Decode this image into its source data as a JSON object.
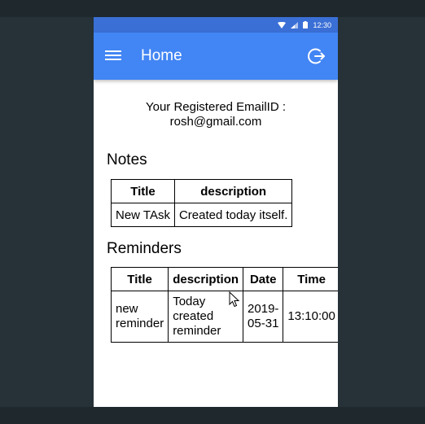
{
  "statusbar": {
    "time": "12:30"
  },
  "appbar": {
    "title": "Home"
  },
  "email": {
    "label": "Your Registered EmailID :",
    "value": "rosh@gmail.com"
  },
  "notes": {
    "title": "Notes",
    "headers": [
      "Title",
      "description"
    ],
    "rows": [
      [
        "New TAsk",
        "Created today itself."
      ]
    ]
  },
  "reminders": {
    "title": "Reminders",
    "headers": [
      "Title",
      "description",
      "Date",
      "Time"
    ],
    "rows": [
      [
        "new reminder",
        "Today created reminder",
        "2019-05-31",
        "13:10:00"
      ]
    ]
  },
  "colors": {
    "appbar": "#4285f4",
    "statusbar": "#3a6fd6",
    "backdrop": "#263238"
  },
  "icons": {
    "menu": "hamburger-icon",
    "logout": "logout-icon",
    "wifi": "wifi-icon",
    "signal": "signal-icon",
    "battery": "battery-icon"
  }
}
